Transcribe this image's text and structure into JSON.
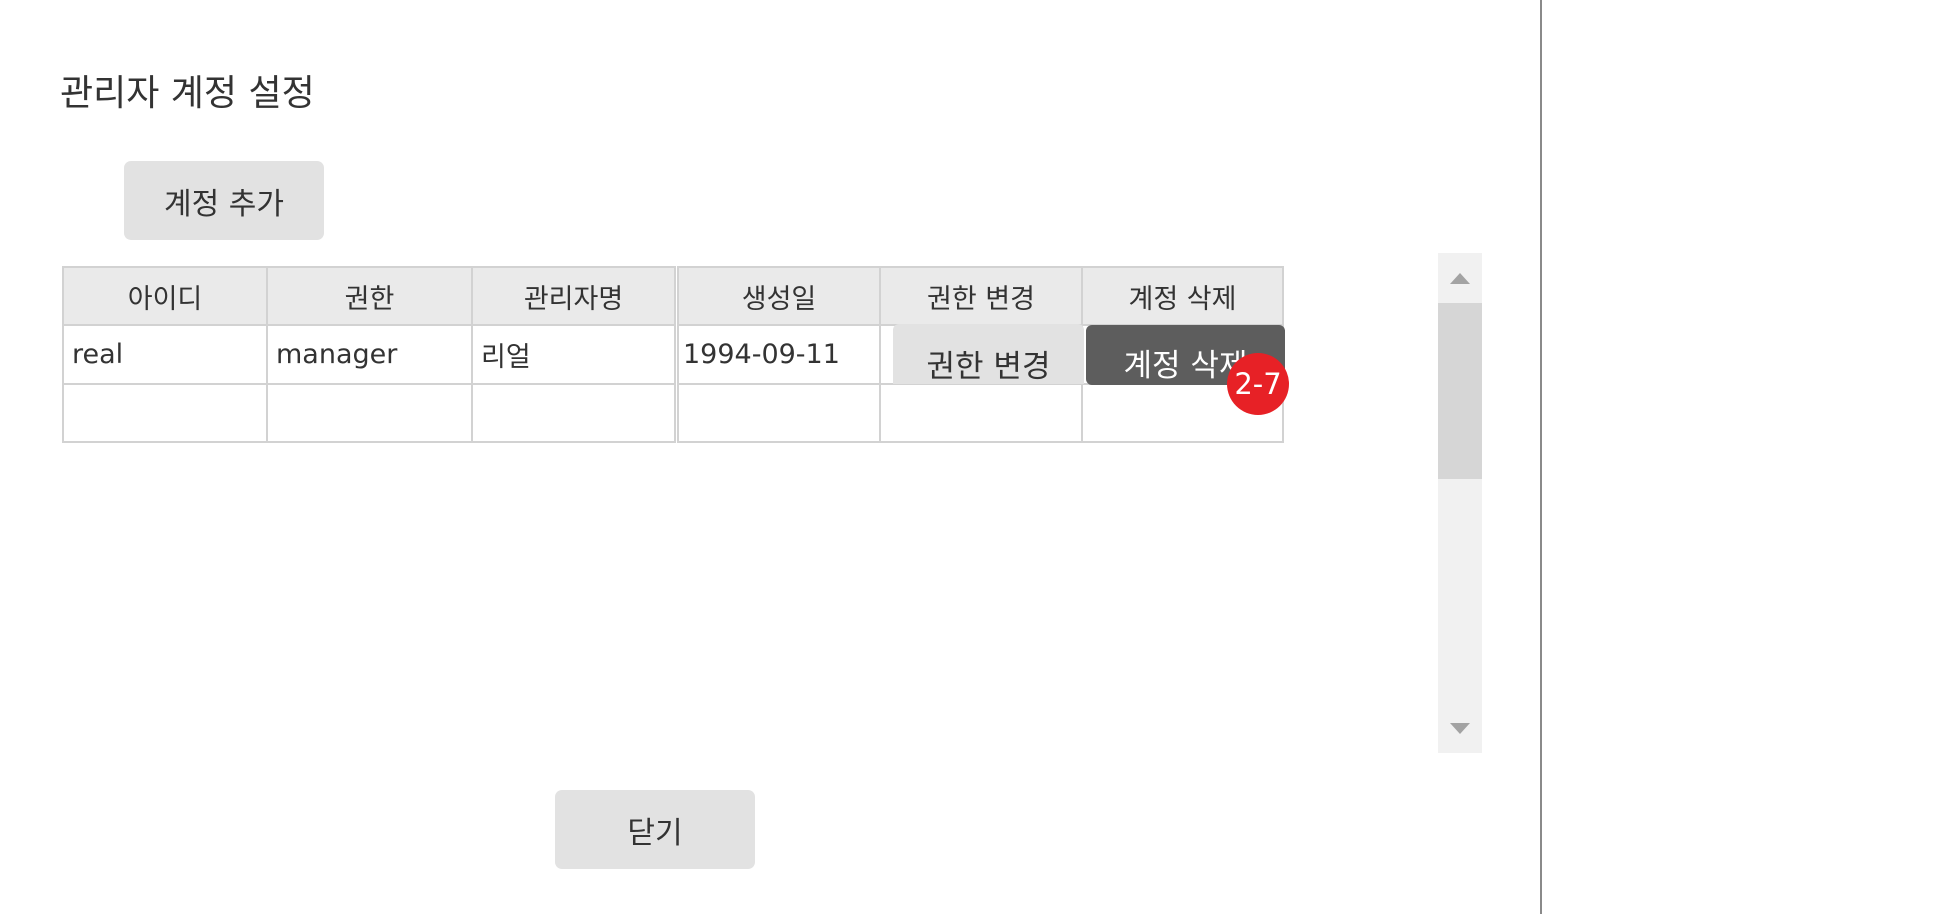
{
  "title": "관리자 계정 설정",
  "buttons": {
    "add_account": "계정 추가",
    "close": "닫기"
  },
  "table": {
    "headers": [
      "아이디",
      "권한",
      "관리자명",
      "생성일",
      "권한 변경",
      "계정 삭제"
    ],
    "rows": [
      {
        "id": "real",
        "role": "manager",
        "name": "리얼",
        "created": "1994-09-11",
        "change_role_label": "권한 변경",
        "delete_label": "계정 삭제"
      }
    ]
  },
  "badge": "2-7",
  "colors": {
    "header_bg": "#eaeaea",
    "button_bg": "#e2e2e2",
    "delete_button_bg": "#5d5d5d",
    "badge_bg": "#e72126",
    "scrollbar_thumb": "#d6d6d6"
  },
  "icons": {
    "scroll_up": "triangle-up",
    "scroll_down": "triangle-down"
  }
}
